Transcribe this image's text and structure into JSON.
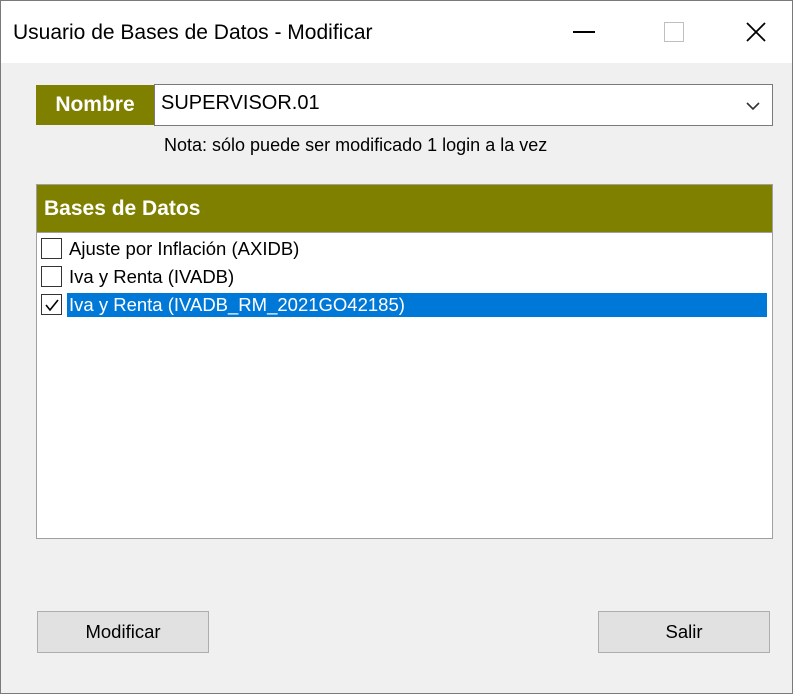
{
  "window": {
    "title": "Usuario de Bases de Datos - Modificar"
  },
  "form": {
    "name_label": "Nombre",
    "name_value": "SUPERVISOR.01",
    "note": "Nota: sólo puede ser modificado 1 login a la vez"
  },
  "databases": {
    "header": "Bases de Datos",
    "items": [
      {
        "label": "Ajuste por Inflación (AXIDB)",
        "checked": false,
        "selected": false
      },
      {
        "label": "Iva y Renta (IVADB)",
        "checked": false,
        "selected": false
      },
      {
        "label": "Iva y Renta (IVADB_RM_2021GO42185)",
        "checked": true,
        "selected": true
      }
    ]
  },
  "buttons": {
    "modify_label": "Modificar",
    "exit_label": "Salir"
  },
  "colors": {
    "header_bg": "#808000",
    "selection_bg": "#0078d7",
    "window_bg": "#f0f0f0"
  },
  "icons": {
    "minimize": "minimize-icon",
    "maximize": "maximize-icon",
    "close": "close-icon",
    "dropdown": "chevron-down-icon",
    "checkmark": "checkmark-icon"
  }
}
